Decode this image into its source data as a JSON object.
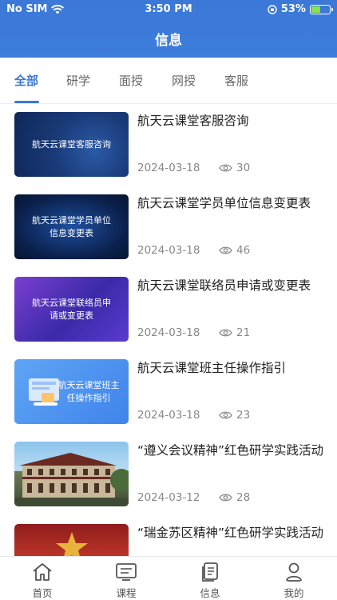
{
  "status": {
    "carrier": "No SIM",
    "time": "3:50 PM",
    "battery": "53%",
    "battery_level": 0.53
  },
  "nav": {
    "title": "信息"
  },
  "tabs": [
    {
      "label": "全部",
      "active": true
    },
    {
      "label": "研学",
      "active": false
    },
    {
      "label": "面授",
      "active": false
    },
    {
      "label": "网授",
      "active": false
    },
    {
      "label": "客服",
      "active": false
    }
  ],
  "items": [
    {
      "title": "航天云课堂客服咨询",
      "thumb_text": "航天云课堂客服咨询",
      "date": "2024-03-18",
      "views": "30"
    },
    {
      "title": "航天云课堂学员单位信息变更表",
      "thumb_text": "航天云课堂学员单位信息变更表",
      "date": "2024-03-18",
      "views": "46"
    },
    {
      "title": "航天云课堂联络员申请或变更表",
      "thumb_text": "航天云课堂联络员申请或变更表",
      "date": "2024-03-18",
      "views": "21"
    },
    {
      "title": "航天云课堂班主任操作指引",
      "thumb_text": "航天云课堂班主任操作指引",
      "date": "2024-03-18",
      "views": "23"
    },
    {
      "title": "“遵义会议精神”红色研学实践活动",
      "thumb_text": "",
      "date": "2024-03-12",
      "views": "28"
    },
    {
      "title": "“瑞金苏区精神”红色研学实践活动",
      "thumb_text": "",
      "date": "",
      "views": ""
    }
  ],
  "bottom_tabs": [
    {
      "label": "首页",
      "icon": "home-icon"
    },
    {
      "label": "课程",
      "icon": "course-icon"
    },
    {
      "label": "信息",
      "icon": "info-icon"
    },
    {
      "label": "我的",
      "icon": "profile-icon"
    }
  ],
  "colors": {
    "primary": "#3a78d6",
    "header": "#3d7ddb"
  }
}
